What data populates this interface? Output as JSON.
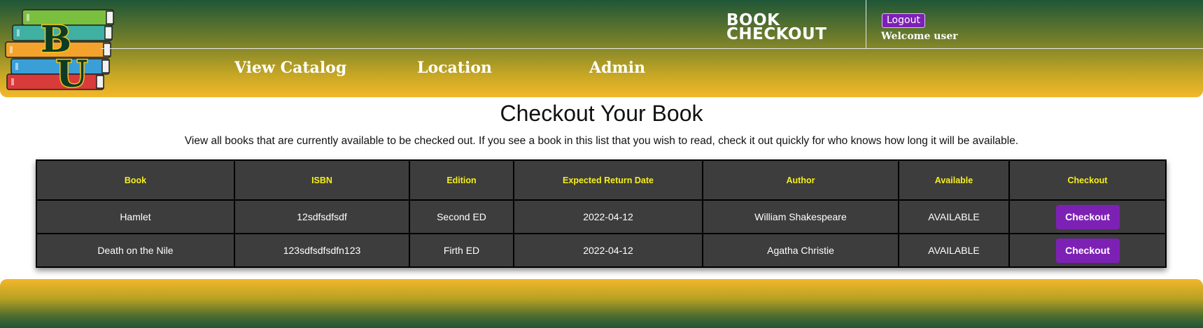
{
  "header": {
    "logo_icon": "baylor-bu-books-logo",
    "brand_line1": "BOOK",
    "brand_line2": "CHECKOUT",
    "logout_label": "Logout",
    "welcome_text": "Welcome user",
    "nav": [
      {
        "label": "View Catalog"
      },
      {
        "label": "Location"
      },
      {
        "label": "Admin"
      }
    ],
    "colors": {
      "green": "#1f5637",
      "gold": "#f2b72a",
      "purple": "#7d21b5"
    }
  },
  "main": {
    "title": "Checkout Your Book",
    "description": "View all books that are currently available to be checked out. If you see a book in this list that you wish to read, check it out quickly for who knows how long it will be available.",
    "table": {
      "columns": [
        "Book",
        "ISBN",
        "Edition",
        "Expected Return Date",
        "Author",
        "Available",
        "Checkout"
      ],
      "rows": [
        {
          "book": "Hamlet",
          "isbn": "12sdfsdfsdf",
          "edition": "Second ED",
          "return_date": "2022-04-12",
          "author": "William Shakespeare",
          "available": "AVAILABLE",
          "action": "Checkout"
        },
        {
          "book": "Death on the Nile",
          "isbn": "123sdfsdfsdfn123",
          "edition": "Firth ED",
          "return_date": "2022-04-12",
          "author": "Agatha Christie",
          "available": "AVAILABLE",
          "action": "Checkout"
        }
      ],
      "header_text_color": "#f7ef1b",
      "cell_background": "#3d3d3d"
    }
  }
}
